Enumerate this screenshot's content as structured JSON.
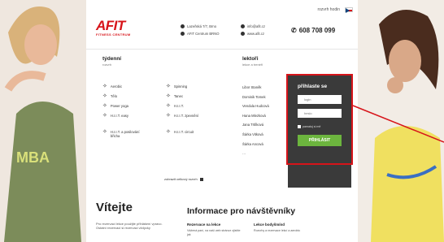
{
  "header": {
    "top_links": "rozvrh hodin",
    "logo_text": "AFIT",
    "logo_subtitle": "FITNESS CENTRUM",
    "address_line1": "Lazeňská 7/7, Brno",
    "address_line2": "AFIT Centrum BRNO",
    "email": "info@afit.cz",
    "web": "www.afit.cz",
    "phone": "608 708 099"
  },
  "sections": {
    "weekly_title": "týdenní",
    "weekly_sub": "rozvrh",
    "trainers_title": "lektoři",
    "trainers_sub": "lekce a trenéři"
  },
  "classes": [
    {
      "label": "Aerobic",
      "icon": "aerobic-figure-icon"
    },
    {
      "label": "Spinning",
      "icon": "spinning-figure-icon"
    },
    {
      "label": "Tělo",
      "icon": "body-figure-icon"
    },
    {
      "label": "Tanec",
      "icon": "dance-figure-icon"
    },
    {
      "label": "Power yoga",
      "icon": "yoga-figure-icon"
    },
    {
      "label": "H.I.I.T.",
      "icon": "hiit-figure-icon"
    },
    {
      "label": "H.I.I.T. easy",
      "icon": "hiit-easy-figure-icon"
    },
    {
      "label": "H.I.I.T. zpevnění",
      "icon": "hiit-firming-figure-icon"
    },
    {
      "label": "H.I.I.T. a posilování břicha",
      "icon": "hiit-abs-figure-icon"
    },
    {
      "label": "H.I.I.T. circuit",
      "icon": "hiit-circuit-figure-icon"
    }
  ],
  "trainers": [
    "Libor Staněk",
    "Dominik Tomek",
    "Vendula Hudcová",
    "Hana Mlezková",
    "Jana Trtílková",
    "Šárka Vitková",
    "Šárka Ancová",
    "…"
  ],
  "schedule_link": "zobrazit celkový rozvrh",
  "login": {
    "title": "přihlaste se",
    "user_placeholder": "login",
    "pass_placeholder": "heslo",
    "remember_label": "pamatuj si mě",
    "submit_label": "PŘIHLÁSIT"
  },
  "welcome": {
    "title": "Vítejte",
    "text": "Pro rezervaci lekce použijte přihlášení vpravo. Ostatní rezervaci si rezervaci vždycky"
  },
  "info": {
    "title": "Informace pro návštěvníky",
    "col1_title": "Rezervace na lekce",
    "col1_text": "Vážená paní, na naší web stránce zjistíte jak",
    "col2_title": "Lekce bodyšmínd",
    "col2_text": "Rozvrhy a rezervace lekcí a aerobic"
  },
  "colors": {
    "brand_red": "#d7141a",
    "panel_dark": "#3a3a3a",
    "button_green": "#6cb53e"
  }
}
